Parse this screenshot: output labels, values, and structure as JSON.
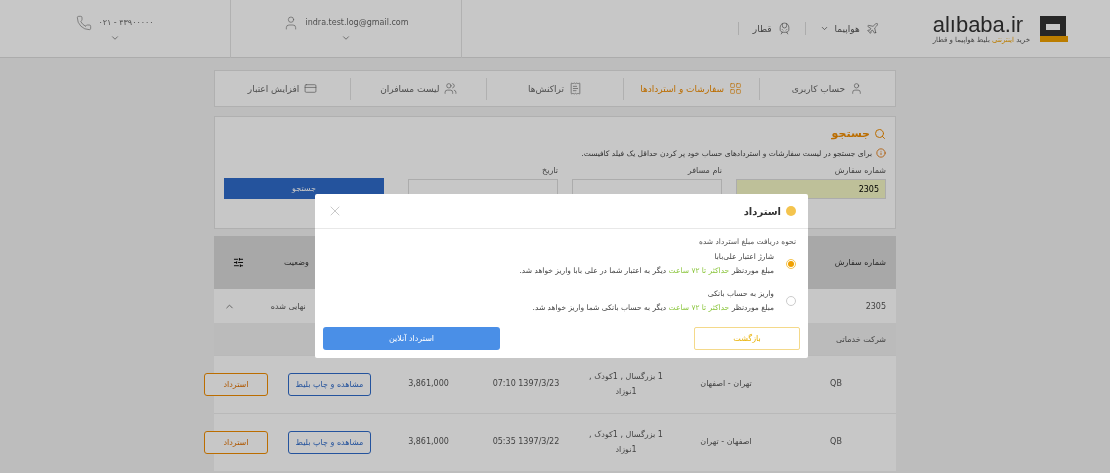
{
  "header": {
    "logo": "alıbaba.ir",
    "tagline": {
      "before": "خرید",
      "highlight": "اینترنتی",
      "after": "بلیط هواپیما و قطار"
    },
    "nav": [
      {
        "label": "هواپیما",
        "kind": "plane",
        "dropdown": true
      },
      {
        "label": "قطار",
        "kind": "train",
        "dropdown": false
      }
    ],
    "email": "indra.test.log@gmail.com",
    "phone": "۰۲۱ - ۴۳۹۰۰۰۰۰"
  },
  "tabs": [
    {
      "label": "حساب کاربری",
      "kind": "user",
      "selected": false
    },
    {
      "label": "سفارشات و استردادها",
      "kind": "orders",
      "selected": true
    },
    {
      "label": "تراکنش‌ها",
      "kind": "transactions",
      "selected": false
    },
    {
      "label": "لیست مسافران",
      "kind": "passengers",
      "selected": false
    },
    {
      "label": "افزایش اعتبار",
      "kind": "credit",
      "selected": false
    }
  ],
  "search": {
    "title": "جستجو",
    "info": "برای جستجو در لیست سفارشات و استردادهای حساب خود پر کردن حداقل یک فیلد کافیست.",
    "fields": [
      {
        "label": "شماره سفارش",
        "value": "2305"
      },
      {
        "label": "نام مسافر"
      },
      {
        "label": "تاریخ"
      }
    ],
    "button": "جستجو"
  },
  "table": {
    "columns": [
      "شماره سفارش",
      "وضعیت"
    ],
    "order": {
      "number": "2305",
      "status": "نهایی شده"
    },
    "sub_column": "شرکت خدماتی",
    "rows": [
      {
        "airline": "QB",
        "route": "تهران - اصفهان",
        "passengers": "1 بزرگسال , 1کودک , 1نوزاد",
        "date": "1397/3/23 07:10",
        "price": "3,861,000",
        "view": "مشاهده و چاپ بلیط",
        "refund": "استرداد"
      },
      {
        "airline": "QB",
        "route": "اصفهان - تهران",
        "passengers": "1 بزرگسال , 1کودک , 1نوزاد",
        "date": "1397/3/22 05:35",
        "price": "3,861,000",
        "view": "مشاهده و چاپ بلیط",
        "refund": "استرداد"
      }
    ]
  },
  "modal": {
    "title": "استرداد",
    "prompt": "نحوه دریافت مبلغ استرداد شده",
    "options": [
      {
        "title": "شارژ اعتبار علی‌بابا",
        "selected": true,
        "description": {
          "before": "مبلغ موردنظر",
          "highlight": "حداکثر تا ۷۲ ساعت",
          "after": "دیگر به اعتبار شما در علی بابا واریز خواهد شد."
        }
      },
      {
        "title": "واریز به حساب بانکی",
        "selected": false,
        "description": {
          "before": "مبلغ موردنظر",
          "highlight": "حداکثر تا ۷۲ ساعت",
          "after": "دیگر به حساب بانکی شما واریز خواهد شد."
        }
      }
    ],
    "back": "بازگشت",
    "confirm": "استرداد آنلاین"
  }
}
